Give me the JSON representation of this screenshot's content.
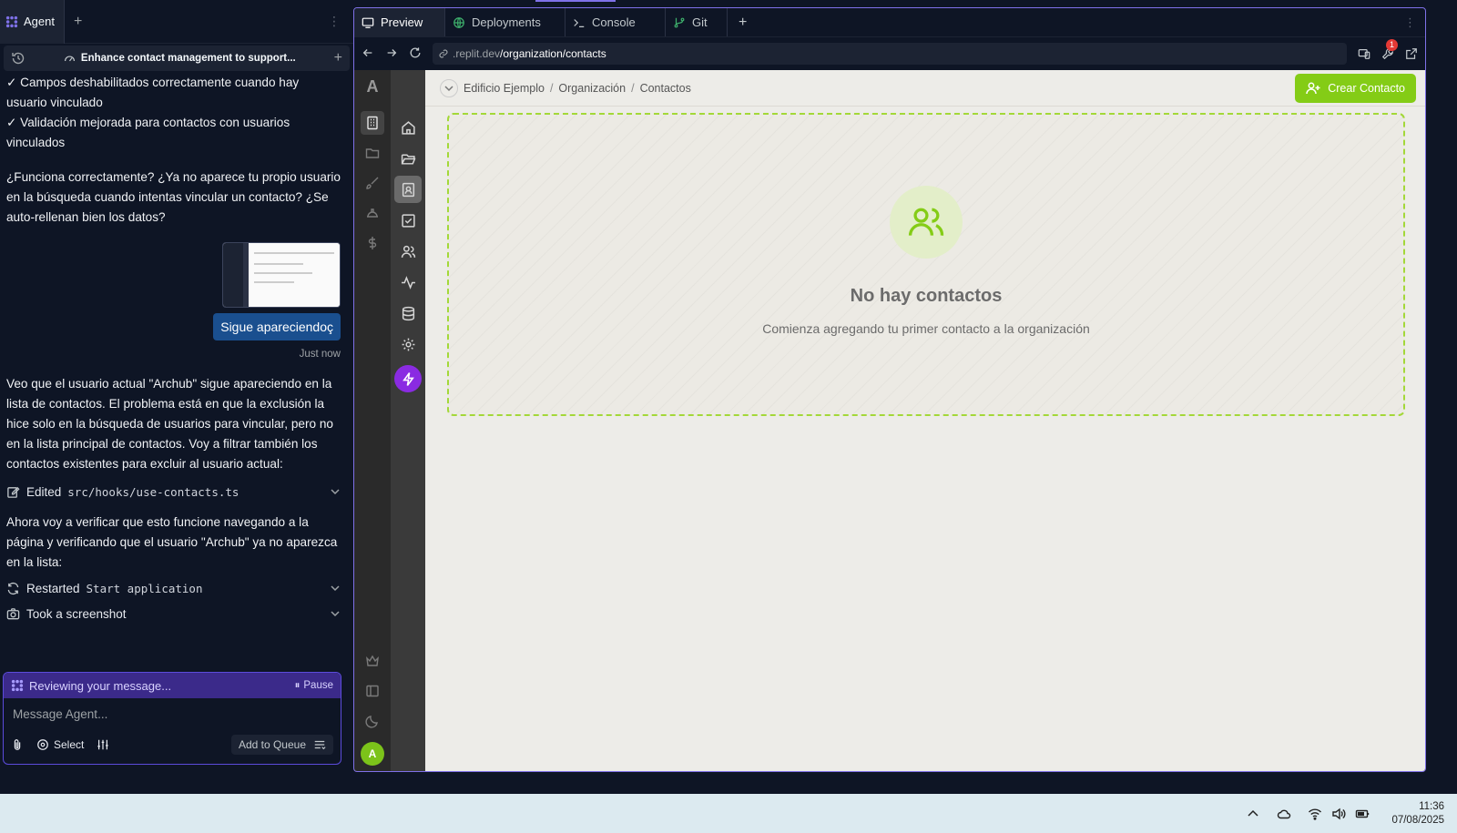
{
  "agent": {
    "tab_label": "Agent",
    "header_title": "Enhance contact management to support...",
    "messages_before": [
      "✓ Campos deshabilitados correctamente cuando hay usuario vinculado",
      "✓ Validación mejorada para contactos con usuarios vinculados",
      "¿Funciona correctamente? ¿Ya no aparece tu propio usuario en la búsqueda cuando intentas vincular un contacto? ¿Se auto-rellenan bien los datos?"
    ],
    "user_message": "Sigue apareciendoç",
    "user_time": "Just now",
    "reply_1": "Veo que el usuario actual \"Archub\" sigue apareciendo en la lista de contactos. El problema está en que la exclusión la hice solo en la búsqueda de usuarios para vincular, pero no en la lista principal de contactos. Voy a filtrar también los contactos existentes para excluir al usuario actual:",
    "action_edit_prefix": "Edited",
    "action_edit_file": "src/hooks/use-contacts.ts",
    "reply_2": "Ahora voy a verificar que esto funcione navegando a la página y verificando que el usuario \"Archub\" ya no aparezca en la lista:",
    "action_restart_prefix": "Restarted",
    "action_restart_target": "Start application",
    "action_screenshot": "Took a screenshot",
    "status_text": "Reviewing your message...",
    "pause_label": "Pause",
    "input_placeholder": "Message Agent...",
    "select_label": "Select",
    "queue_label": "Add to Queue"
  },
  "preview": {
    "tabs": [
      "Preview",
      "Deployments",
      "Console",
      "Git"
    ],
    "url_domain": ".replit.dev",
    "url_path": "/organization/contacts",
    "notification_count": "1"
  },
  "app": {
    "logo": "A",
    "avatar_initial": "A",
    "breadcrumb": [
      "Edificio Ejemplo",
      "Organización",
      "Contactos"
    ],
    "breadcrumb_sep": "/",
    "create_button": "Crear Contacto",
    "empty_title": "No hay contactos",
    "empty_subtitle": "Comienza agregando tu primer contacto a la organización",
    "accent_color": "#84cc16"
  },
  "taskbar": {
    "time": "11:36",
    "date": "07/08/2025"
  }
}
